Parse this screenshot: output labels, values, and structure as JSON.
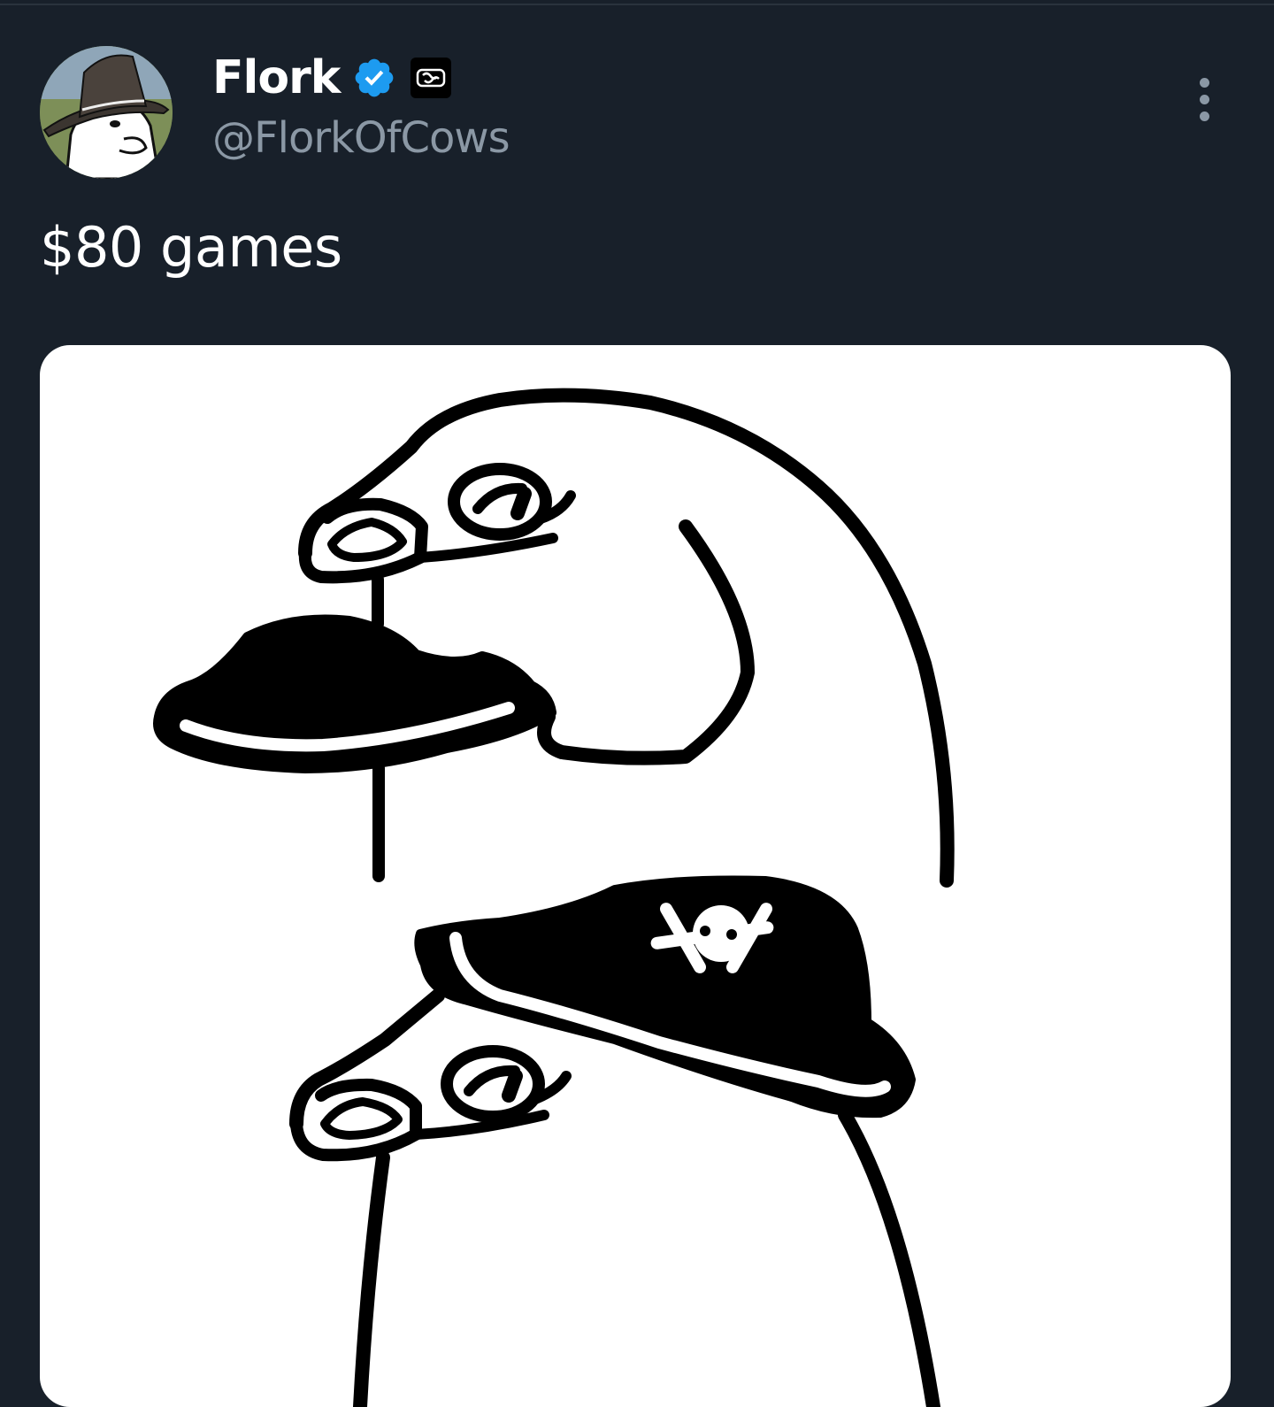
{
  "tweet": {
    "author": {
      "name": "Flork",
      "handle": "@FlorkOfCows",
      "verified": true,
      "verified_color": "#1d9bf0",
      "badge_icon": "affiliate-badge-icon",
      "avatar_icon": "flork-avatar"
    },
    "text": "$80 games",
    "more_icon": "more-options-icon",
    "media": {
      "type": "image",
      "icon": "flork-pirate-meme"
    }
  },
  "colors": {
    "background": "#18202a",
    "text_primary": "#ffffff",
    "text_secondary": "#8b98a5",
    "accent": "#1d9bf0"
  }
}
